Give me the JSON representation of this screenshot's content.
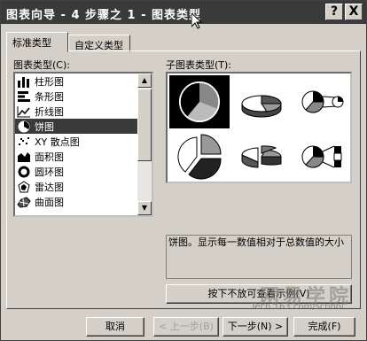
{
  "window": {
    "title": "图表向导 - 4 步骤之 1 - 图表类型",
    "help_btn": "?",
    "close_btn": "X"
  },
  "tabs": [
    {
      "label": "标准类型"
    },
    {
      "label": "自定义类型"
    }
  ],
  "chart_type_label": "图表类型(C):",
  "chart_types": [
    {
      "label": "柱形图",
      "icon": "bar-chart-icon"
    },
    {
      "label": "条形图",
      "icon": "horizontal-bar-chart-icon"
    },
    {
      "label": "折线图",
      "icon": "line-chart-icon"
    },
    {
      "label": "饼图",
      "icon": "pie-chart-icon",
      "selected": true
    },
    {
      "label": "XY 散点图",
      "icon": "scatter-chart-icon"
    },
    {
      "label": "面积图",
      "icon": "area-chart-icon"
    },
    {
      "label": "圆环图",
      "icon": "doughnut-chart-icon"
    },
    {
      "label": "雷达图",
      "icon": "radar-chart-icon"
    },
    {
      "label": "曲面图",
      "icon": "surface-chart-icon"
    }
  ],
  "subtype_label": "子图表类型(T):",
  "description": "饼图。显示每一数值相对于总数值的大小",
  "buttons": {
    "preview": "按下不放可查看示例(V)",
    "cancel": "取消",
    "back": "< 上一步(B)",
    "next": "下一步(N) >",
    "finish": "完成(F)"
  },
  "watermark": {
    "cn": "网易学院",
    "url": "Tech.163.com/school"
  }
}
